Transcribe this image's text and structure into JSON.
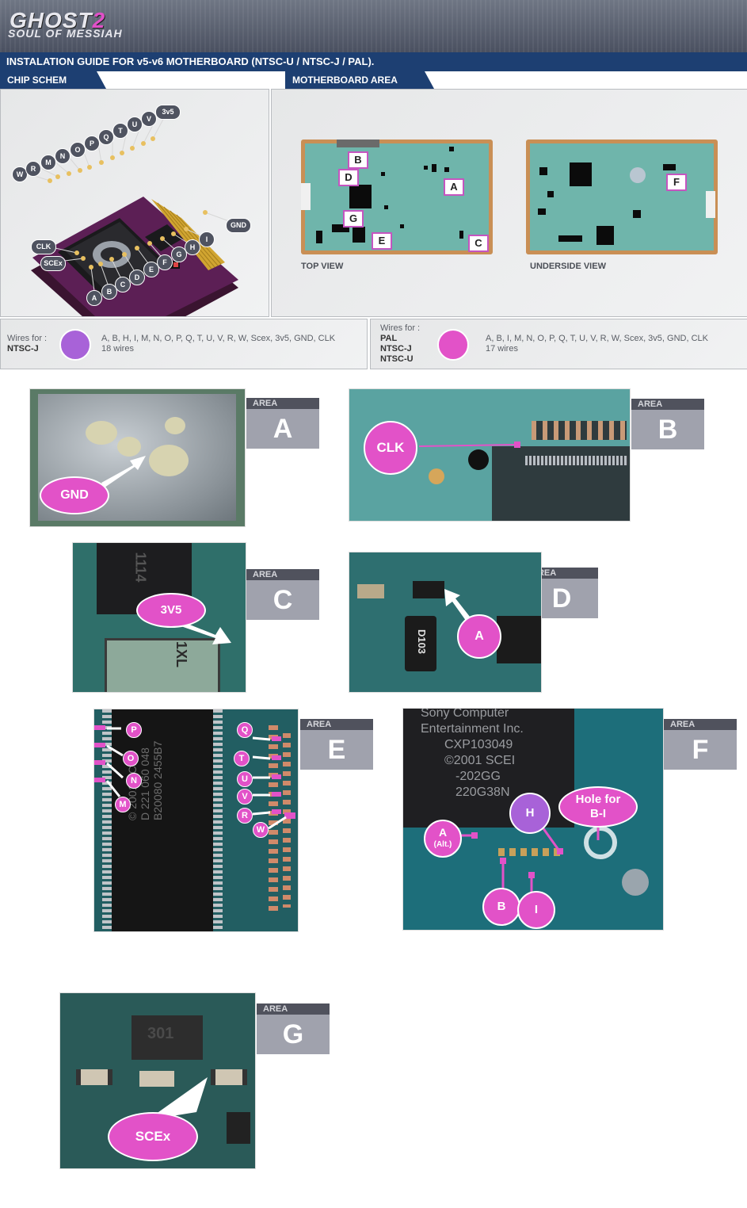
{
  "header": {
    "logo_word": "GHOST",
    "logo_num": "2",
    "logo_sub": "SOUL OF MESSIAH",
    "title": "INSTALATION GUIDE FOR v5-v6 MOTHERBOARD (NTSC-U / NTSC-J / PAL)."
  },
  "tabs": {
    "chip": "CHIP SCHEM",
    "mobo": "MOTHERBOARD AREA"
  },
  "chip_pins": {
    "top": [
      "W",
      "R",
      "M",
      "N",
      "O",
      "P",
      "Q",
      "T",
      "U",
      "V"
    ],
    "bottom": [
      "A",
      "B",
      "C",
      "D",
      "E",
      "F",
      "G",
      "H",
      "I"
    ],
    "v3v5": "3v5",
    "gnd": "GND",
    "clk": "CLK",
    "scex": "SCEx"
  },
  "motherboard": {
    "top_labels": [
      "A",
      "B",
      "C",
      "D",
      "E",
      "G"
    ],
    "under_label": "F",
    "top_view": "TOP VIEW",
    "under_view": "UNDERSIDE VIEW"
  },
  "wires": {
    "ntscj": {
      "prefix": "Wires for :",
      "regions": [
        "NTSC-J"
      ],
      "list": "A, B, H, I, M, N, O, P, Q, T, U, V, R, W, Scex, 3v5, GND, CLK",
      "count": "18 wires",
      "color": "#a862d8"
    },
    "pal": {
      "prefix": "Wires for :",
      "regions": [
        "PAL",
        "NTSC-J",
        "NTSC-U"
      ],
      "list": "A, B, I, M, N, O, P, Q, T, U, V, R, W, Scex, 3v5, GND, CLK",
      "count": "17 wires",
      "color": "#e252c8"
    }
  },
  "area_word": "AREA",
  "areas": {
    "A": {
      "letter": "A",
      "label": "GND"
    },
    "B": {
      "letter": "B",
      "label": "CLK"
    },
    "C": {
      "letter": "C",
      "label": "3V5",
      "chip_text": "1114",
      "inductor": "1XL"
    },
    "D": {
      "letter": "D",
      "label": "A",
      "chip_text": "D103"
    },
    "E": {
      "letter": "E",
      "pins_left": [
        "P",
        "O",
        "N",
        "M"
      ],
      "pins_right": [
        "Q",
        "T",
        "U",
        "V",
        "R",
        "W"
      ],
      "chip_text": "© 2001 SCEI",
      "chip_text2": "D 221 060 048",
      "chip_text3": "B20080 2455B7"
    },
    "F": {
      "letter": "F",
      "chip_lines": [
        "Sony Computer",
        "Entertainment Inc.",
        "CXP103049",
        "©2001 SCEI",
        "-202GG",
        "220G38N"
      ],
      "a_alt": "A",
      "a_alt_sub": "(Alt.)",
      "h": "H",
      "hole": "Hole for",
      "hole2": "B-I",
      "b": "B",
      "i": "I"
    },
    "G": {
      "letter": "G",
      "label": "SCEx",
      "chip_text": "301"
    }
  }
}
